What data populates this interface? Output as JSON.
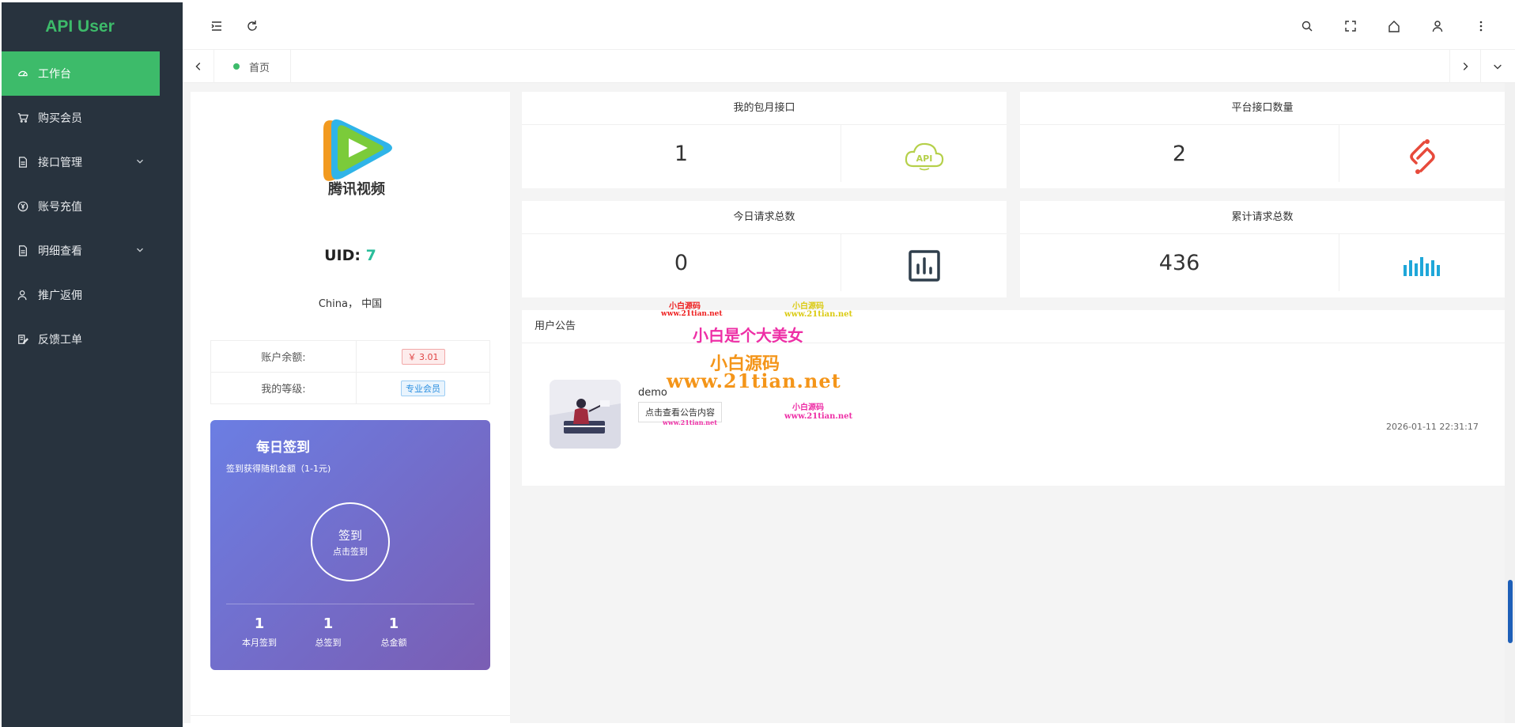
{
  "sidebar": {
    "brand": "API User",
    "items": [
      {
        "label": "工作台",
        "icon": "dashboard-icon"
      },
      {
        "label": "购买会员",
        "icon": "cart-icon"
      },
      {
        "label": "接口管理",
        "icon": "file-icon"
      },
      {
        "label": "账号充值",
        "icon": "yen-icon"
      },
      {
        "label": "明细查看",
        "icon": "file-icon"
      },
      {
        "label": "推广返佣",
        "icon": "user-icon"
      },
      {
        "label": "反馈工单",
        "icon": "edit-icon"
      }
    ]
  },
  "tabs": {
    "home": "首页"
  },
  "profile": {
    "uid_label": "UID:",
    "uid_value": "7",
    "location": "China， 中国",
    "balance_label": "账户余额:",
    "balance_value": "￥ 3.01",
    "level_label": "我的等级:",
    "level_value": "专业会员",
    "logo_text": "腾讯视频"
  },
  "signin": {
    "title": "每日签到",
    "subtitle": "签到获得随机金额（1-1元)",
    "button": "签到",
    "button_sub": "点击签到",
    "stats": [
      {
        "value": "1",
        "label": "本月签到"
      },
      {
        "value": "1",
        "label": "总签到"
      },
      {
        "value": "1",
        "label": "总金额"
      }
    ]
  },
  "cards": [
    {
      "title": "我的包月接口",
      "value": "1",
      "icon": "cloud-api-icon",
      "color": "#b5d04a"
    },
    {
      "title": "平台接口数量",
      "value": "2",
      "icon": "link-icon",
      "color": "#e74a3b"
    },
    {
      "title": "今日请求总数",
      "value": "0",
      "icon": "bar-chart-icon",
      "color": "#2f3e4c"
    },
    {
      "title": "累计请求总数",
      "value": "436",
      "icon": "equalizer-icon",
      "color": "#1fa7d9"
    }
  ],
  "notice": {
    "title": "用户公告",
    "item_title": "demo",
    "button": "点击查看公告内容",
    "time": "2026-01-11 22:31:17"
  },
  "watermark": {
    "line1": "小白源码",
    "url": "www.21tian.net",
    "big": "小白是个大美女"
  }
}
